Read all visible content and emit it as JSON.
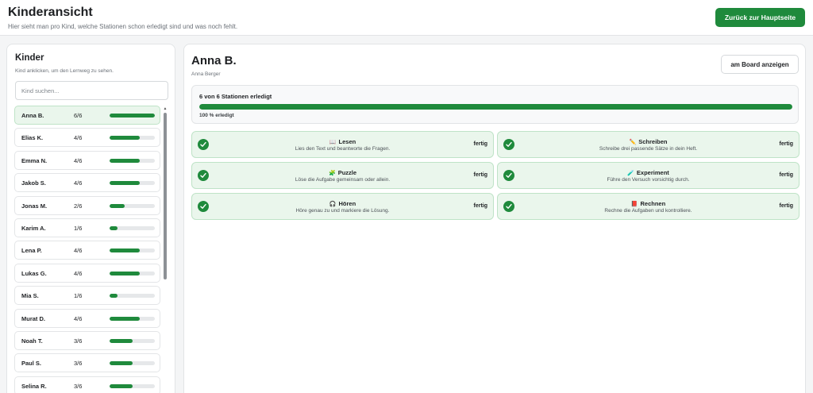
{
  "header": {
    "title": "Kinderansicht",
    "subtitle": "Hier sieht man pro Kind, welche Stationen schon erledigt sind und was noch fehlt.",
    "back_button": "Zurück zur Hauptseite"
  },
  "sidebar": {
    "title": "Kinder",
    "hint": "Kind anklicken, um den Lernweg zu sehen.",
    "search_placeholder": "Kind suchen...",
    "kids": [
      {
        "name": "Anna B.",
        "count": "6/6",
        "progress": 1.0,
        "active": true
      },
      {
        "name": "Elias K.",
        "count": "4/6",
        "progress": 0.667
      },
      {
        "name": "Emma N.",
        "count": "4/6",
        "progress": 0.667
      },
      {
        "name": "Jakob S.",
        "count": "4/6",
        "progress": 0.667
      },
      {
        "name": "Jonas M.",
        "count": "2/6",
        "progress": 0.333
      },
      {
        "name": "Karim A.",
        "count": "1/6",
        "progress": 0.167
      },
      {
        "name": "Lena P.",
        "count": "4/6",
        "progress": 0.667
      },
      {
        "name": "Lukas G.",
        "count": "4/6",
        "progress": 0.667
      },
      {
        "name": "Mia S.",
        "count": "1/6",
        "progress": 0.167
      },
      {
        "name": "Murat D.",
        "count": "4/6",
        "progress": 0.667
      },
      {
        "name": "Noah T.",
        "count": "3/6",
        "progress": 0.5
      },
      {
        "name": "Paul S.",
        "count": "3/6",
        "progress": 0.5
      },
      {
        "name": "Selina R.",
        "count": "3/6",
        "progress": 0.5
      }
    ]
  },
  "main": {
    "name": "Anna B.",
    "full_name": "Anna Berger",
    "board_button": "am Board anzeigen",
    "progress_text": "6 von 6 Stationen erledigt",
    "progress_value": 1.0,
    "progress_pct": "100 % erledigt",
    "stations": [
      {
        "icon": "📖",
        "icon_name": "book-icon",
        "title": "Lesen",
        "desc": "Lies den Text und beantworte die Fragen.",
        "status": "fertig"
      },
      {
        "icon": "✏️",
        "icon_name": "pencil-icon",
        "title": "Schreiben",
        "desc": "Schreibe drei passende Sätze in dein Heft.",
        "status": "fertig"
      },
      {
        "icon": "🧩",
        "icon_name": "puzzle-icon",
        "title": "Puzzle",
        "desc": "Löse die Aufgabe gemeinsam oder allein.",
        "status": "fertig"
      },
      {
        "icon": "🧪",
        "icon_name": "flask-icon",
        "title": "Experiment",
        "desc": "Führe den Versuch vorsichtig durch.",
        "status": "fertig"
      },
      {
        "icon": "🎧",
        "icon_name": "headphones-icon",
        "title": "Hören",
        "desc": "Höre genau zu und markiere die Lösung.",
        "status": "fertig"
      },
      {
        "icon": "📕",
        "icon_name": "calculator-book-icon",
        "title": "Rechnen",
        "desc": "Rechne die Aufgaben und kontrolliere.",
        "status": "fertig"
      }
    ]
  },
  "colors": {
    "accent": "#1f8a3c",
    "done_bg": "#eaf6ec",
    "done_border": "#bfe3c7"
  }
}
